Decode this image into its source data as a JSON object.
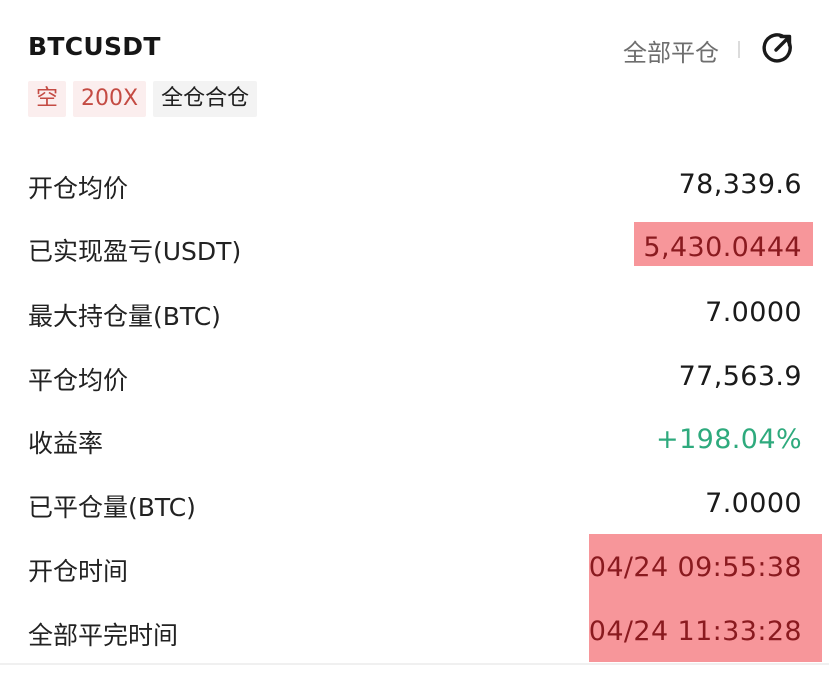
{
  "header": {
    "symbol": "BTCUSDT",
    "close_all_label": "全部平仓",
    "share_icon": "share-icon"
  },
  "tags": {
    "side": "空",
    "leverage": "200X",
    "margin_mode": "全仓合仓"
  },
  "rows": [
    {
      "label": "开仓均价",
      "value": "78,339.6"
    },
    {
      "label": "已实现盈亏(USDT)",
      "value": "5,430.0444"
    },
    {
      "label": "最大持仓量(BTC)",
      "value": "7.0000"
    },
    {
      "label": "平仓均价",
      "value": "77,563.9"
    },
    {
      "label": "收益率",
      "value": "+198.04%"
    },
    {
      "label": "已平仓量(BTC)",
      "value": "7.0000"
    },
    {
      "label": "开仓时间",
      "value": "04/24 09:55:38"
    },
    {
      "label": "全部平完时间",
      "value": "04/24 11:33:28"
    }
  ],
  "colors": {
    "positive": "#2eaa7d",
    "highlight": "#f7969a",
    "tag_red": "#c44b43"
  }
}
